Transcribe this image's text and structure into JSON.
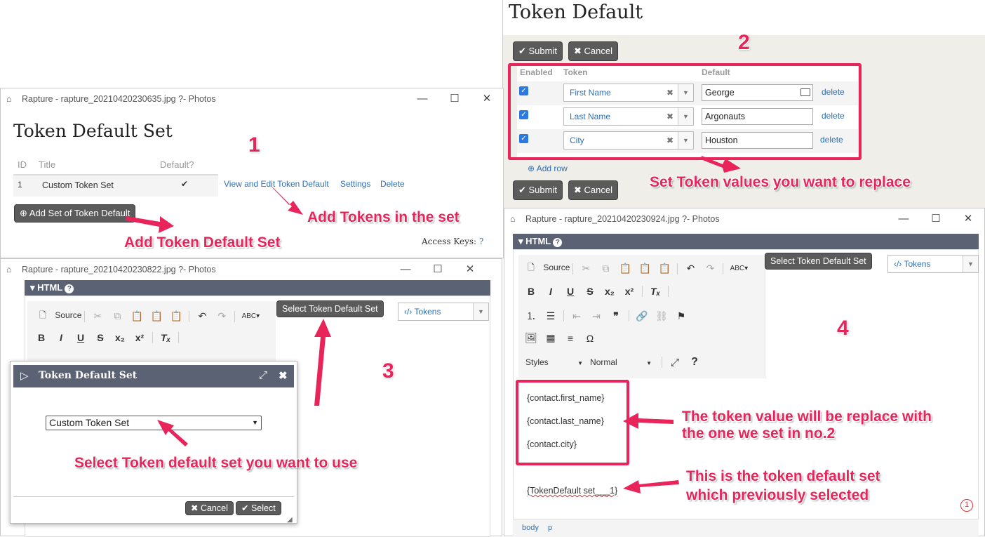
{
  "win1": {
    "title": "Rapture - rapture_20210420230635.jpg ?- Photos",
    "heading": "Token Default Set",
    "columns": [
      "ID",
      "Title",
      "Default?"
    ],
    "row": {
      "id": "1",
      "title": "Custom Token Set",
      "default": "✔",
      "view_edit": "View and Edit Token Default",
      "settings": "Settings",
      "delete": "Delete"
    },
    "add_button": "Add Set of Token Default",
    "access_keys": "Access Keys:"
  },
  "win2": {
    "heading": "Token Default",
    "submit": "Submit",
    "cancel": "Cancel",
    "columns": [
      "Enabled",
      "Token",
      "Default"
    ],
    "rows": [
      {
        "token": "First Name",
        "value": "George",
        "delete": "delete"
      },
      {
        "token": "Last Name",
        "value": "Argonauts",
        "delete": "delete"
      },
      {
        "token": "City",
        "value": "Houston",
        "delete": "delete"
      }
    ],
    "add_row": "Add row"
  },
  "win3": {
    "title": "Rapture - rapture_20210420230822.jpg ?- Photos",
    "panel": "HTML",
    "source": "Source",
    "select_set_btn": "Select Token Default Set",
    "tokens": "Tokens",
    "dialog": {
      "title": "Token Default Set",
      "option": "Custom Token Set",
      "cancel": "Cancel",
      "select": "Select"
    }
  },
  "win4": {
    "title": "Rapture - rapture_20210420230924.jpg ?- Photos",
    "panel": "HTML",
    "source": "Source",
    "select_set_btn": "Select Token Default Set",
    "tokens": "Tokens",
    "styles": "Styles",
    "format": "Normal",
    "content": [
      "{contact.first_name}",
      "{contact.last_name}",
      "{contact.city}"
    ],
    "token_set": "{TokenDefault set___1}",
    "path": [
      "body",
      "p"
    ],
    "badge": "1"
  },
  "annotations": {
    "n1": "1",
    "n2": "2",
    "n3": "3",
    "n4": "4",
    "add_tokens": "Add Tokens in the set",
    "add_set": "Add Token Default Set",
    "set_values": "Set Token values you want to replace",
    "select_set": "Select Token default set you want to use",
    "replace_line1": "The token value will be replace with",
    "replace_line2": "the one we set in no.2",
    "previous_line1": "This is the token default set",
    "previous_line2": "which previously selected"
  },
  "colors": {
    "accent": "#e8245a",
    "panel": "#5a6274",
    "link": "#2f6fb3",
    "checkbox": "#2a7ae2"
  }
}
